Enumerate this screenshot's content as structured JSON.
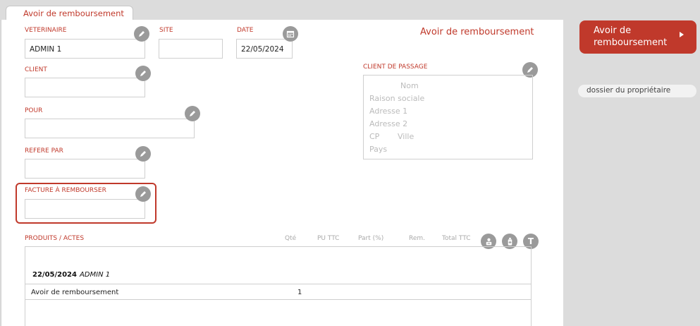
{
  "tab": "Avoir de remboursement",
  "title": "Avoir de remboursement",
  "fields": {
    "veterinaire": {
      "label": "VETERINAIRE",
      "value": "ADMIN 1"
    },
    "site": {
      "label": "SITE",
      "value": ""
    },
    "date": {
      "label": "DATE",
      "value": "22/05/2024"
    },
    "client": {
      "label": "CLIENT",
      "value": ""
    },
    "pour": {
      "label": "POUR",
      "value": ""
    },
    "refere": {
      "label": "REFERE PAR",
      "value": ""
    },
    "facture": {
      "label": "FACTURE À REMBOURSER",
      "value": ""
    }
  },
  "client_passage": {
    "label": "CLIENT DE PASSAGE",
    "nom": "Nom",
    "raison": "Raison sociale",
    "adresse1": "Adresse 1",
    "adresse2": "Adresse 2",
    "cp": "CP",
    "ville": "Ville",
    "pays": "Pays"
  },
  "products": {
    "label": "PRODUITS / ACTES",
    "columns": [
      "Qté",
      "PU TTC",
      "Part (%)",
      "Rem.",
      "Total TTC"
    ],
    "group_date": "22/05/2024",
    "group_user": "ADMIN 1",
    "rows": [
      {
        "name": "Avoir de remboursement",
        "qty": "1"
      }
    ],
    "icon_t": "T"
  },
  "sidebar": {
    "button": "Avoir de remboursement",
    "link": "dossier du propriétaire"
  },
  "colors": {
    "accent": "#c0392b"
  }
}
